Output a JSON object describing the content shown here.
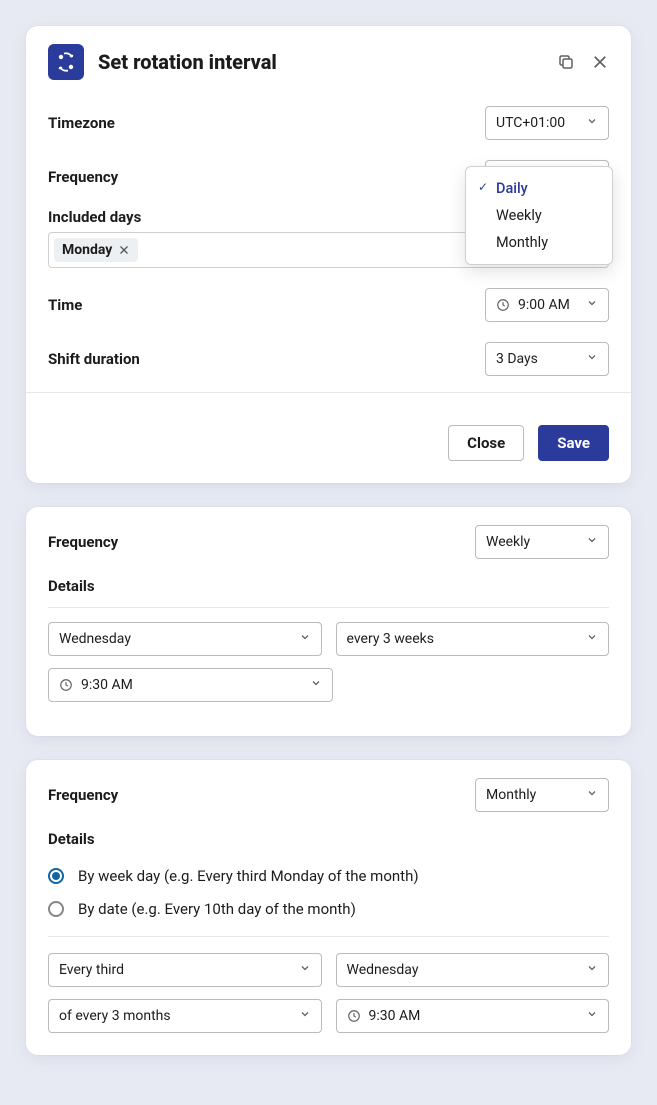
{
  "modal": {
    "title": "Set rotation interval",
    "timezone": {
      "label": "Timezone",
      "value": "UTC+01:00"
    },
    "frequency": {
      "label": "Frequency",
      "value": "Daily"
    },
    "frequency_options": [
      "Daily",
      "Weekly",
      "Monthly"
    ],
    "included_days": {
      "label": "Included days",
      "chip": "Monday"
    },
    "time": {
      "label": "Time",
      "value": "9:00 AM"
    },
    "shift_duration": {
      "label": "Shift duration",
      "value": "3 Days"
    },
    "close_btn": "Close",
    "save_btn": "Save"
  },
  "weekly": {
    "freq_label": "Frequency",
    "freq_value": "Weekly",
    "details_label": "Details",
    "day": "Wednesday",
    "cadence": "every 3 weeks",
    "time": "9:30 AM"
  },
  "monthly": {
    "freq_label": "Frequency",
    "freq_value": "Monthly",
    "details_label": "Details",
    "option_a": "By week day (e.g. Every third Monday of the month)",
    "option_b": "By date (e.g. Every 10th day of the month)",
    "ordinal": "Every third",
    "day": "Wednesday",
    "cadence": "of every 3 months",
    "time": "9:30 AM"
  }
}
